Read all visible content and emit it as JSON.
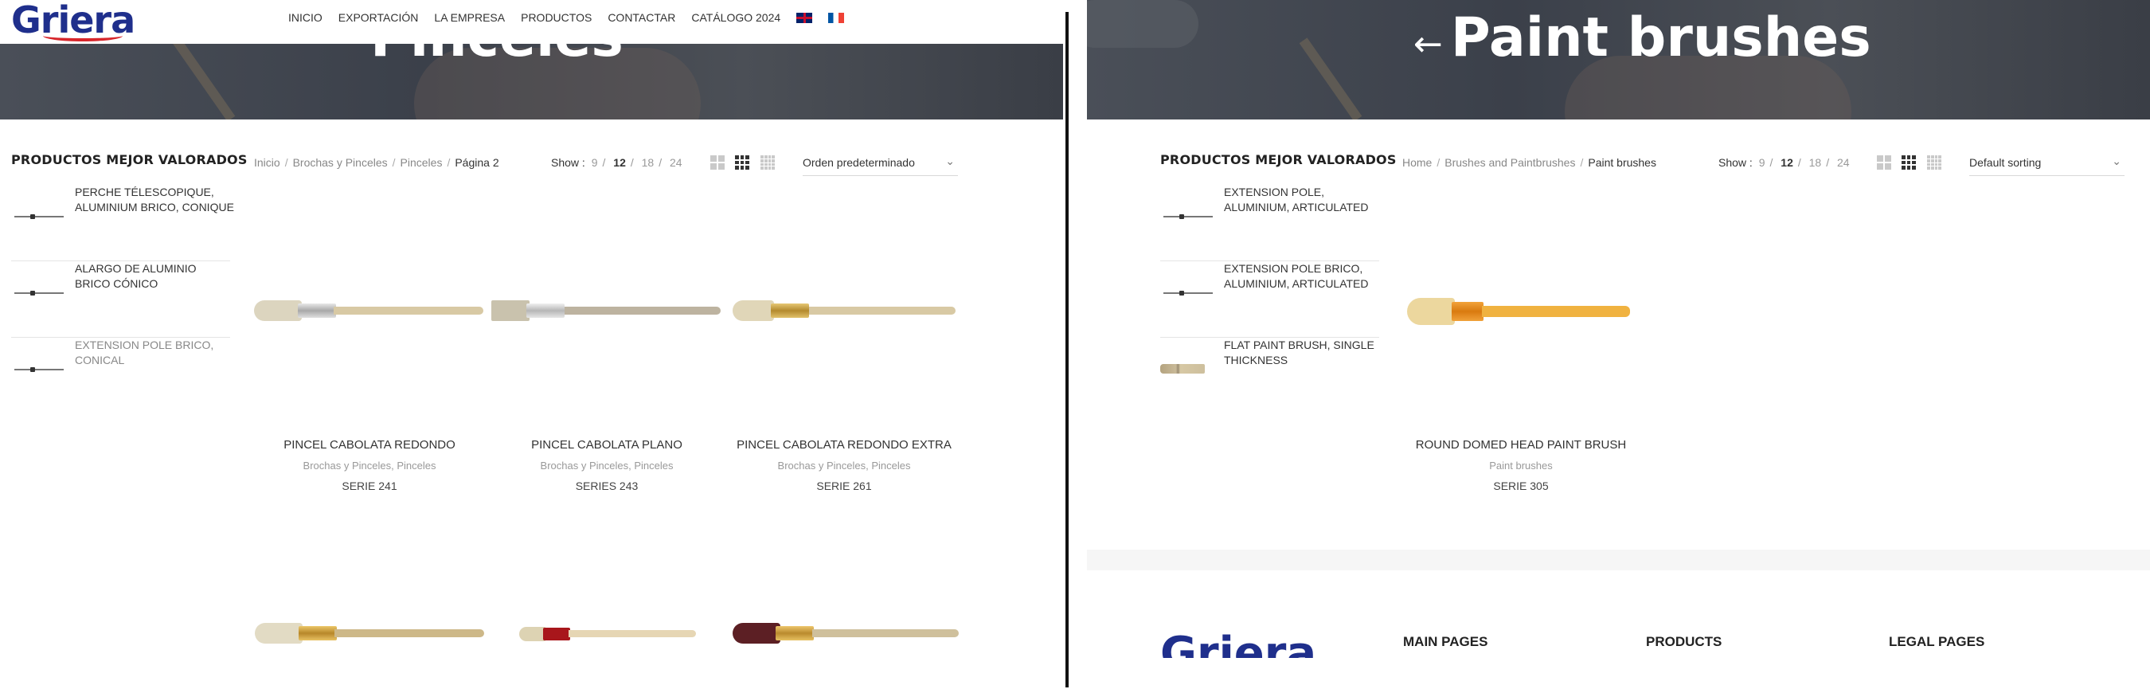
{
  "left": {
    "logo": "Griera",
    "nav": [
      "INICIO",
      "EXPORTACIÓN",
      "LA EMPRESA",
      "PRODUCTOS",
      "CONTACTAR",
      "CATÁLOGO 2024"
    ],
    "hero_title": "Pinceles",
    "sidebar_title": "PRODUCTOS MEJOR VALORADOS",
    "sidebar_items": [
      "PERCHE TÉLESCOPIQUE, ALUMINIUM BRICO, CONIQUE",
      "ALARGO DE ALUMINIO BRICO CÓNICO",
      "EXTENSION POLE BRICO, CONICAL"
    ],
    "breadcrumb": [
      "Inicio",
      "Brochas y Pinceles",
      "Pinceles",
      "Página 2"
    ],
    "show_label": "Show :",
    "show_options": [
      "9",
      "12",
      "18",
      "24"
    ],
    "show_selected": "12",
    "sort": "Orden predeterminado",
    "products": [
      {
        "name": "PINCEL CABOLATA REDONDO",
        "cat1": "Brochas y Pinceles",
        "cat2": "Pinceles",
        "serie": "SERIE 241"
      },
      {
        "name": "PINCEL CABOLATA PLANO",
        "cat1": "Brochas y Pinceles",
        "cat2": "Pinceles",
        "serie": "SERIES 243"
      },
      {
        "name": "PINCEL CABOLATA REDONDO EXTRA",
        "cat1": "Brochas y Pinceles",
        "cat2": "Pinceles",
        "serie": "SERIE 261"
      }
    ]
  },
  "right": {
    "hero_back_arrow": "←",
    "hero_title": "Paint brushes",
    "sidebar_title": "PRODUCTOS MEJOR VALORADOS",
    "sidebar_items": [
      "EXTENSION POLE, ALUMINIUM, ARTICULATED",
      "EXTENSION POLE BRICO, ALUMINIUM, ARTICULATED",
      "FLAT PAINT BRUSH, SINGLE THICKNESS"
    ],
    "breadcrumb": [
      "Home",
      "Brushes and Paintbrushes",
      "Paint brushes"
    ],
    "show_label": "Show :",
    "show_options": [
      "9",
      "12",
      "18",
      "24"
    ],
    "show_selected": "12",
    "sort": "Default sorting",
    "products": [
      {
        "name": "ROUND DOMED HEAD PAINT BRUSH",
        "cat1": "Paint brushes",
        "serie": "SERIE 305"
      }
    ],
    "footer_logo": "Griera",
    "footer_headings": [
      "MAIN PAGES",
      "PRODUCTS",
      "LEGAL PAGES"
    ]
  },
  "colors": {
    "brand_blue": "#1f2f8c",
    "brand_red": "#d7262b",
    "hero_overlay": "#3f444d"
  },
  "icons": [
    "flag-uk-icon",
    "flag-fr-icon",
    "grid-2-icon",
    "grid-3-icon",
    "grid-4-icon",
    "chevron-down-icon",
    "arrow-left-icon"
  ]
}
